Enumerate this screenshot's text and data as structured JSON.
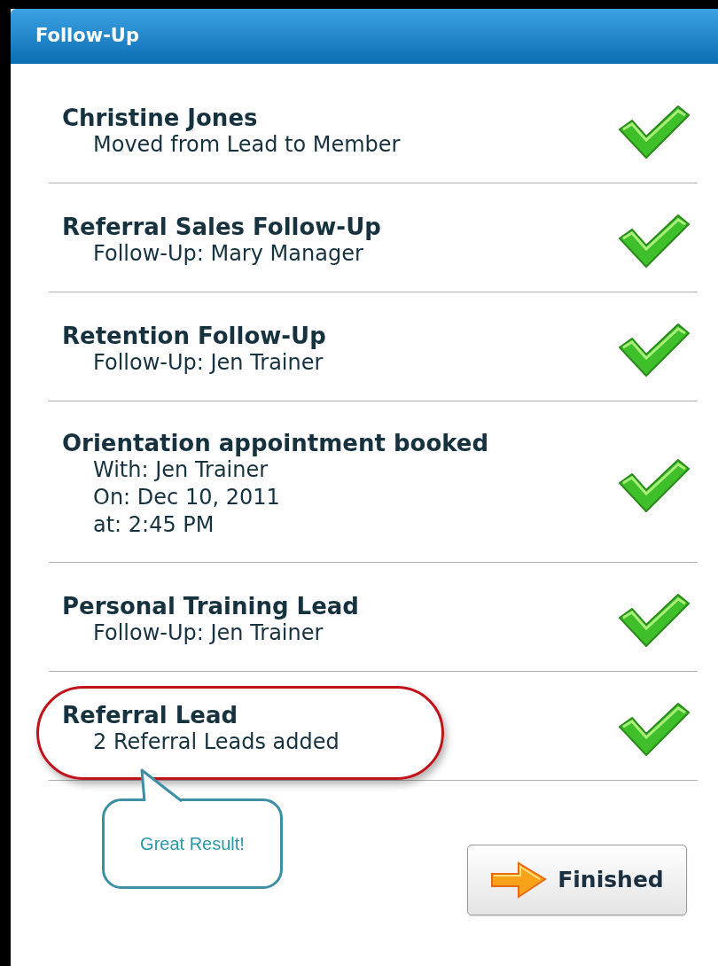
{
  "window": {
    "title": "Follow-Up"
  },
  "items": [
    {
      "title": "Christine Jones",
      "details": [
        "Moved from Lead to Member"
      ],
      "done": true,
      "circled": false
    },
    {
      "title": "Referral Sales Follow-Up",
      "details": [
        "Follow-Up: Mary Manager"
      ],
      "done": true,
      "circled": false
    },
    {
      "title": "Retention Follow-Up",
      "details": [
        "Follow-Up: Jen Trainer"
      ],
      "done": true,
      "circled": false
    },
    {
      "title": "Orientation appointment booked",
      "details": [
        "With: Jen Trainer",
        "On: Dec 10, 2011",
        "at: 2:45 PM"
      ],
      "done": true,
      "circled": false
    },
    {
      "title": "Personal Training Lead",
      "details": [
        "Follow-Up: Jen Trainer"
      ],
      "done": true,
      "circled": false
    },
    {
      "title": "Referral Lead",
      "details": [
        "2 Referral Leads added"
      ],
      "done": true,
      "circled": true
    }
  ],
  "callout": "Great Result!",
  "finish_button": "Finished"
}
